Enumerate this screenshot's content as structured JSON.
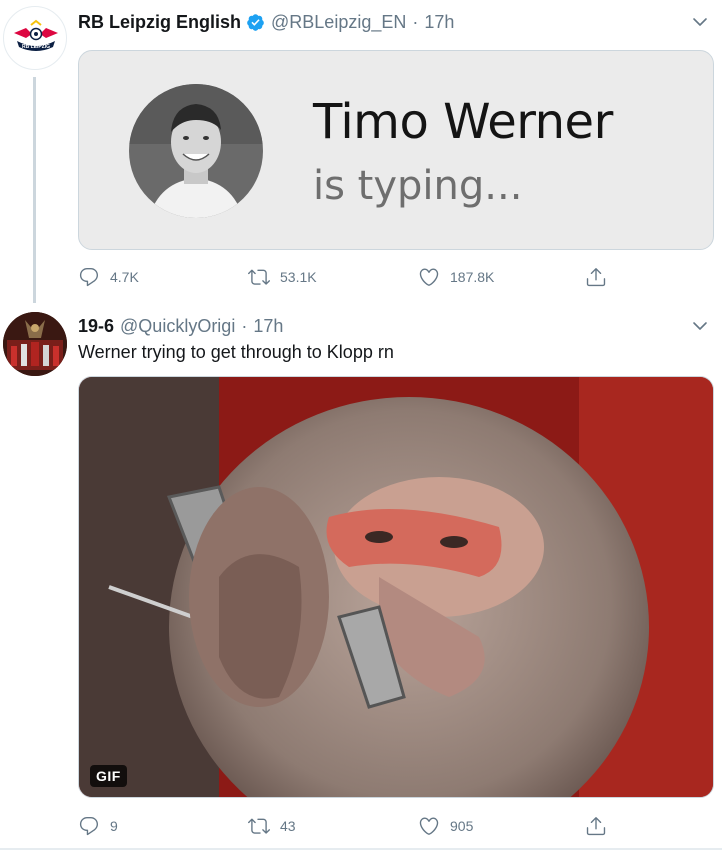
{
  "tweets": [
    {
      "author": {
        "name": "RB Leipzig English",
        "handle": "@RBLeipzig_EN",
        "verified": true,
        "logo_text": "RB LEIPZIG"
      },
      "time": "17h",
      "card": {
        "title": "Timo Werner",
        "subtitle": "is typing..."
      },
      "actions": {
        "replies": "4.7K",
        "retweets": "53.1K",
        "likes": "187.8K"
      }
    },
    {
      "author": {
        "name": "19-6",
        "handle": "@QuicklyOrigi"
      },
      "time": "17h",
      "text": "Werner trying to get through to Klopp rn",
      "media": {
        "badge": "GIF"
      },
      "actions": {
        "replies": "9",
        "retweets": "43",
        "likes": "905"
      }
    }
  ],
  "separator": "·",
  "colors": {
    "text": "#14171a",
    "secondary": "#657786",
    "verified": "#1da1f2",
    "border": "#ccd6dd"
  },
  "icons": [
    "chevron-down-icon",
    "verified-badge-icon",
    "reply-icon",
    "retweet-icon",
    "like-icon",
    "share-icon"
  ]
}
